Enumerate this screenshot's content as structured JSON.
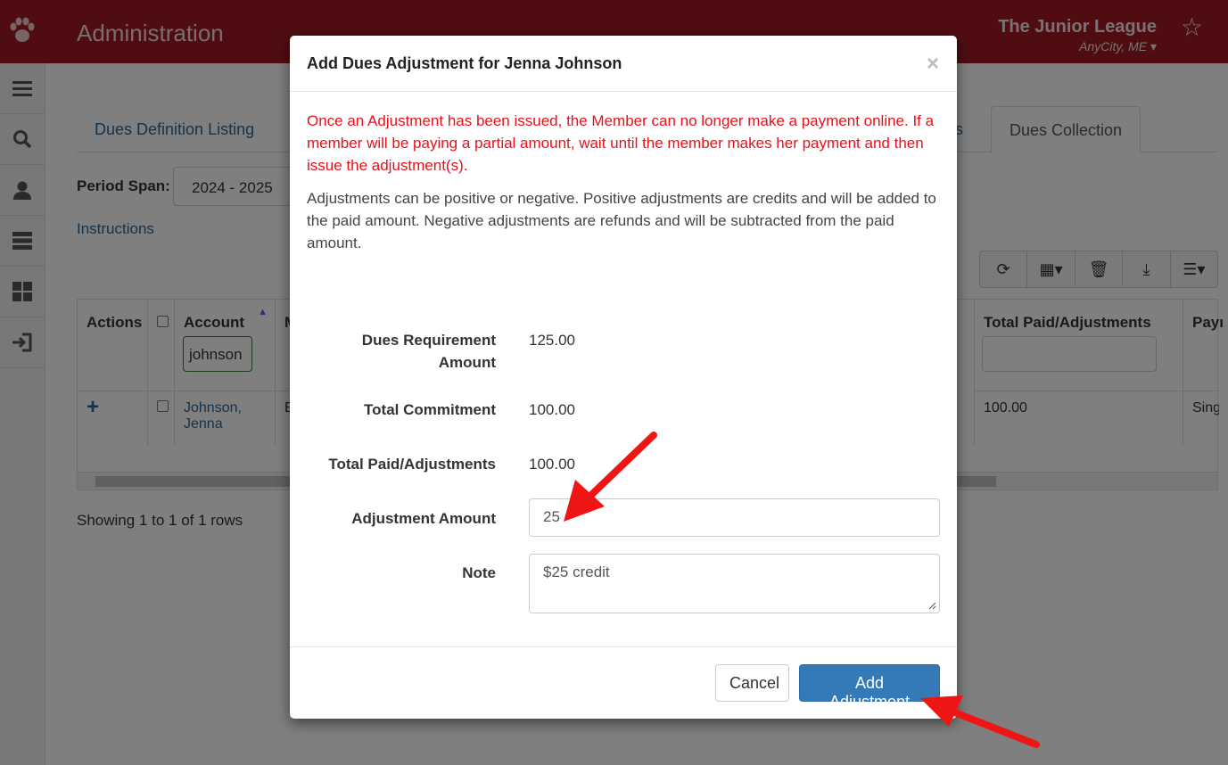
{
  "header": {
    "title": "Administration",
    "org_name": "The Junior League",
    "org_city": "AnyCity, ME",
    "brand_color": "#9e1b24"
  },
  "sidebar": {
    "icons": [
      "menu-icon",
      "search-icon",
      "user-icon",
      "server-icon",
      "grid-icon",
      "sign-in-icon"
    ]
  },
  "tabs": [
    {
      "label": "Dues Definition Listing"
    },
    {
      "label": "ns"
    },
    {
      "label": "Dues Collection"
    }
  ],
  "period": {
    "label": "Period Span:",
    "value": "2024 - 2025"
  },
  "instructions_link": "Instructions",
  "table": {
    "headers": [
      "Actions",
      "Account",
      "M",
      "Total Paid/Adjustments",
      "Payı"
    ],
    "account_filter": "johnson",
    "row": {
      "account": "Johnson, Jenna",
      "col3": "E",
      "total_paid": "100.00",
      "payment": "Singl"
    }
  },
  "showing_text": "Showing 1 to 1 of 1 rows",
  "modal": {
    "title": "Add Dues Adjustment for Jenna Johnson",
    "close": "×",
    "warning": "Once an Adjustment has been issued, the Member can no longer make a payment online. If a member will be paying a partial amount, wait until the member makes her payment and then issue the adjustment(s).",
    "info": "Adjustments can be positive or negative. Positive adjustments are credits and will be added to the paid amount. Negative adjustments are refunds and will be subtracted from the paid amount.",
    "fields": {
      "dues_requirement_label": "Dues Requirement Amount",
      "dues_requirement_value": "125.00",
      "total_commitment_label": "Total Commitment",
      "total_commitment_value": "100.00",
      "total_paid_label": "Total Paid/Adjustments",
      "total_paid_value": "100.00",
      "adjustment_label": "Adjustment Amount",
      "adjustment_value": "25",
      "note_label": "Note",
      "note_value": "$25 credit"
    },
    "cancel_label": "Cancel",
    "add_label": "Add Adjustment",
    "warning_color": "#e8101a",
    "primary_color": "#337ab7"
  },
  "annotation_color": "#f01515"
}
